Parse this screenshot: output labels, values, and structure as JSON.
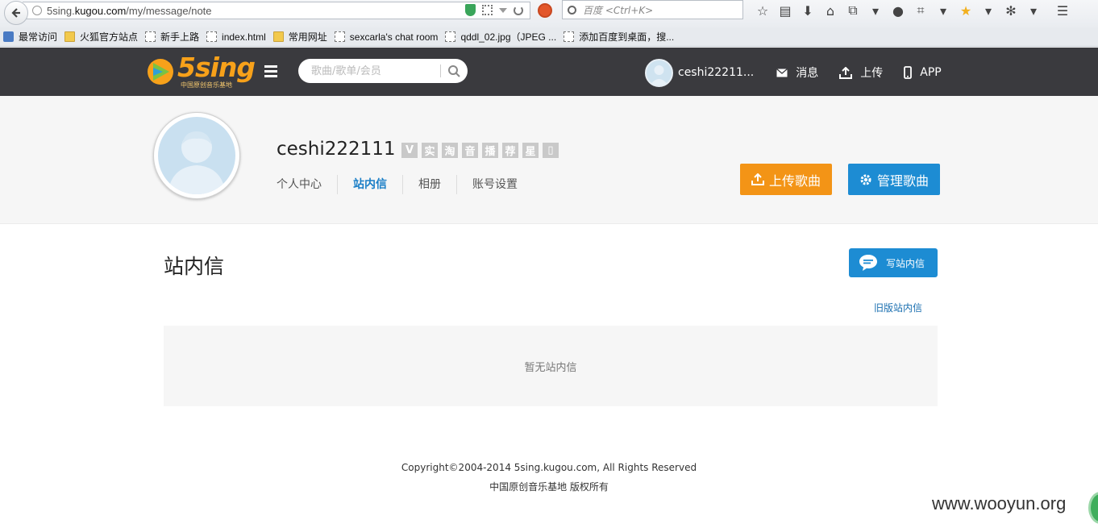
{
  "browser": {
    "url_prefix": "5sing.",
    "url_domain": "kugou.com",
    "url_path": "/my/message/note",
    "search_placeholder": "百度 <Ctrl+K>",
    "bookmarks": [
      {
        "label": "最常访问",
        "icon": "blue"
      },
      {
        "label": "火狐官方站点",
        "icon": "folder"
      },
      {
        "label": "新手上路",
        "icon": "page"
      },
      {
        "label": "index.html",
        "icon": "page"
      },
      {
        "label": "常用网址",
        "icon": "folder"
      },
      {
        "label": "sexcarla's chat room",
        "icon": "page"
      },
      {
        "label": "qddl_02.jpg（JPEG ...",
        "icon": "page"
      },
      {
        "label": "添加百度到桌面，搜...",
        "icon": "page"
      }
    ]
  },
  "header": {
    "logo_text": "5sing",
    "logo_sub": "中国原创音乐基地",
    "search_placeholder": "歌曲/歌单/会员",
    "user_name": "ceshi22211...",
    "nav": {
      "messages": "消息",
      "upload": "上传",
      "app": "APP"
    }
  },
  "profile": {
    "name": "ceshi222111",
    "badges": [
      "V",
      "实",
      "淘",
      "音",
      "播",
      "荐",
      "星",
      "▯"
    ],
    "tabs": [
      {
        "label": "个人中心",
        "active": false
      },
      {
        "label": "站内信",
        "active": true
      },
      {
        "label": "相册",
        "active": false
      },
      {
        "label": "账号设置",
        "active": false
      }
    ],
    "upload_button": "上传歌曲",
    "manage_button": "管理歌曲"
  },
  "main": {
    "title": "站内信",
    "write_button": "写站内信",
    "old_link": "旧版站内信",
    "empty_text": "暂无站内信"
  },
  "footer": {
    "copyright": "Copyright©2004-2014 5sing.kugou.com, All Rights Reserved",
    "rights": "中国原创音乐基地 版权所有"
  },
  "watermark": "www.wooyun.org",
  "colors": {
    "header_bg": "#3a3a3e",
    "accent_orange": "#f39416",
    "accent_blue": "#1d8cd3",
    "active_tab": "#1a7ec6"
  }
}
